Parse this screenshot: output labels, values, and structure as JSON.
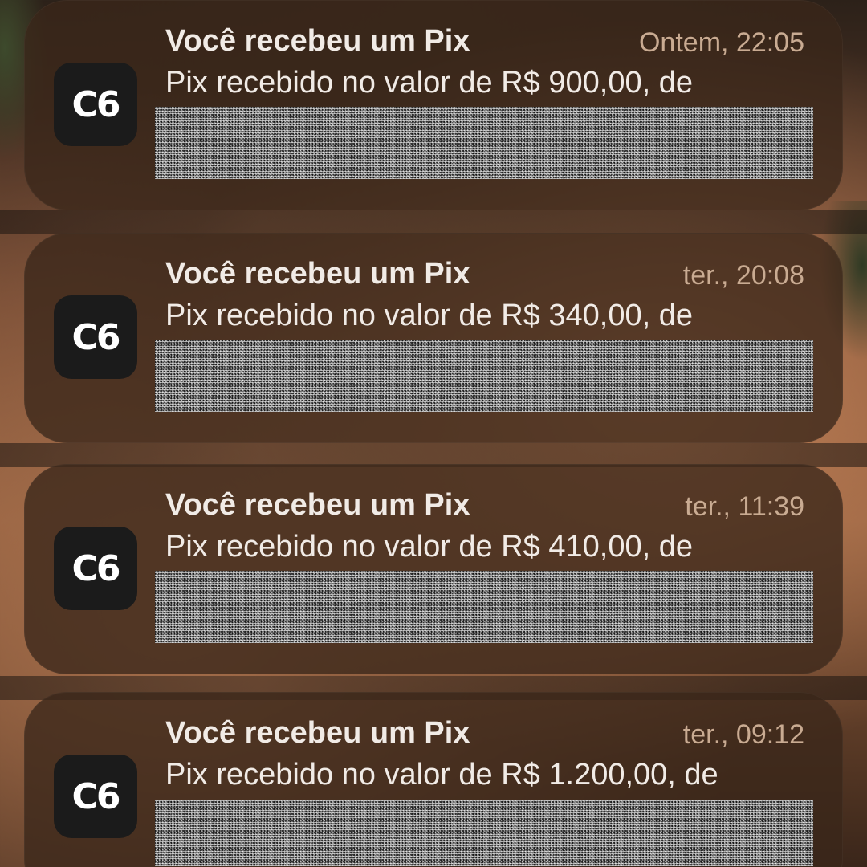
{
  "notifications": [
    {
      "app_icon": "C6",
      "title": "Você recebeu um Pix",
      "time": "Ontem, 22:05",
      "body": "Pix recebido no valor de R$ 900,00, de"
    },
    {
      "app_icon": "C6",
      "title": "Você recebeu um Pix",
      "time": "ter., 20:08",
      "body": "Pix recebido no valor de R$ 340,00, de"
    },
    {
      "app_icon": "C6",
      "title": "Você recebeu um Pix",
      "time": "ter., 11:39",
      "body": "Pix recebido no valor de R$ 410,00, de"
    },
    {
      "app_icon": "C6",
      "title": "Você recebeu um Pix",
      "time": "ter., 09:12",
      "body": "Pix recebido no valor de R$ 1.200,00, de"
    }
  ]
}
